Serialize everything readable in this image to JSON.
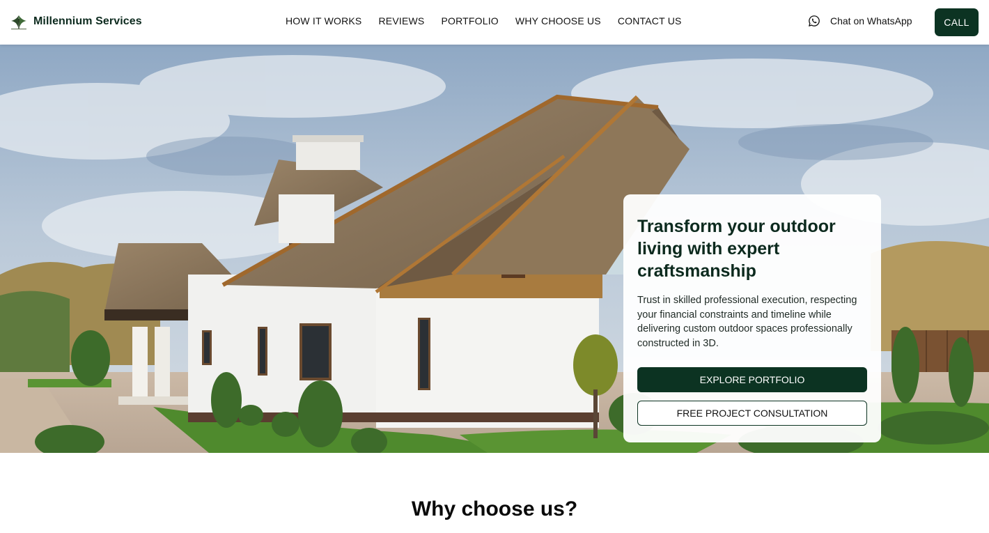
{
  "brand": {
    "name": "Millennium Services",
    "logo_icon": "leaf-logo-icon"
  },
  "nav": {
    "items": [
      {
        "label": "HOW IT WORKS"
      },
      {
        "label": "REVIEWS"
      },
      {
        "label": "PORTFOLIO"
      },
      {
        "label": "WHY CHOOSE US"
      },
      {
        "label": "CONTACT US"
      }
    ]
  },
  "header": {
    "whatsapp_label": "Chat on WhatsApp",
    "whatsapp_icon": "whatsapp-icon",
    "call_label": "CALL"
  },
  "hero": {
    "title": "Transform your outdoor living with expert craftsmanship",
    "text": "Trust in skilled professional execution, respecting your financial constraints and timeline while delivering custom outdoor spaces professionally constructed in 3D.",
    "primary_button": "EXPLORE PORTFOLIO",
    "secondary_button": "FREE PROJECT CONSULTATION"
  },
  "why": {
    "title": "Why choose us?",
    "subtitle": ""
  },
  "colors": {
    "brand_dark_green": "#0c3322",
    "text_dark": "#0c2a1e",
    "sky": "#9fb6cf",
    "roof": "#8b7358",
    "wall": "#f1f1ef",
    "grass": "#4f8a2d"
  }
}
